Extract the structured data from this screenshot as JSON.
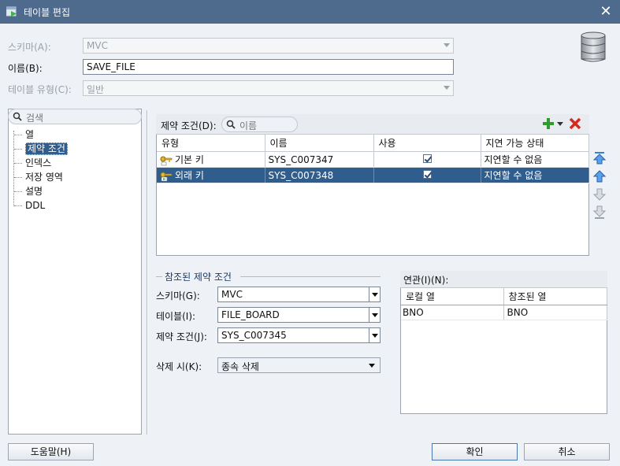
{
  "window": {
    "title": "테이블 편집"
  },
  "form": {
    "schema_label": "스키마(A):",
    "schema_value": "MVC",
    "name_label": "이름(B):",
    "name_value": "SAVE_FILE",
    "table_type_label": "테이블 유형(C):",
    "table_type_value": "일반"
  },
  "left_search": {
    "placeholder": "검색"
  },
  "tree": {
    "items": [
      {
        "label": "열"
      },
      {
        "label": "제약 조건",
        "selected": true
      },
      {
        "label": "인덱스"
      },
      {
        "label": "저장 영역"
      },
      {
        "label": "설명"
      },
      {
        "label": "DDL"
      }
    ]
  },
  "constraints": {
    "label": "제약 조건(D):",
    "search_placeholder": "이름",
    "columns": [
      "유형",
      "이름",
      "사용",
      "지연 가능 상태"
    ],
    "rows": [
      {
        "type": "기본 키",
        "name": "SYS_C007347",
        "enabled": true,
        "deferrable": "지연할 수 없음"
      },
      {
        "type": "외래 키",
        "name": "SYS_C007348",
        "enabled": true,
        "deferrable": "지연할 수 없음",
        "selected": true
      }
    ]
  },
  "referenced": {
    "title": "참조된 제약 조건",
    "schema_label": "스키마(G):",
    "schema_value": "MVC",
    "table_label": "테이블(I):",
    "table_value": "FILE_BOARD",
    "constraint_label": "제약 조건(J):",
    "constraint_value": "SYS_C007345",
    "on_delete_label": "삭제 시(K):",
    "on_delete_value": "종속 삭제"
  },
  "association": {
    "label": "연관(I)(N):",
    "columns": [
      "로컬 열",
      "참조된 열"
    ],
    "rows": [
      {
        "local": "BNO",
        "referenced": "BNO"
      }
    ]
  },
  "buttons": {
    "help": "도움말(H)",
    "ok": "확인",
    "cancel": "취소"
  },
  "colors": {
    "titlebar": "#4e6a8c",
    "selection": "#2f5e8e",
    "add": "#2e9b2e",
    "delete": "#d62a1e"
  }
}
